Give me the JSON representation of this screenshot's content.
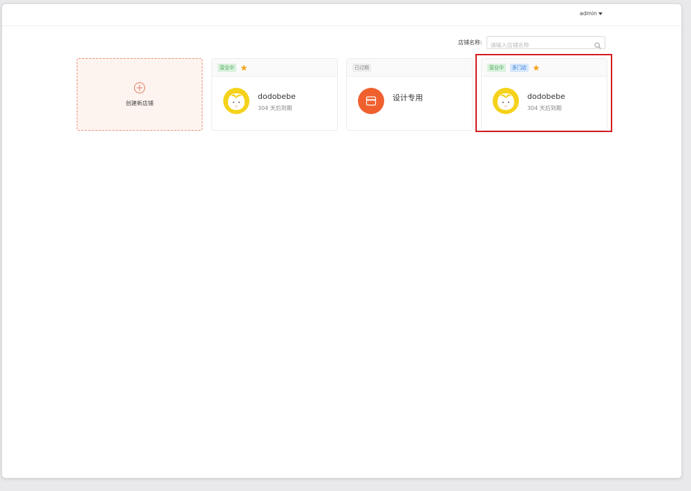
{
  "header": {
    "user": "admin"
  },
  "search": {
    "label": "店铺名称:",
    "placeholder": "请输入店铺名称"
  },
  "create_card": {
    "label": "创建新店铺"
  },
  "stores": [
    {
      "tags": [
        "营业中"
      ],
      "starred": true,
      "name": "dodobebe",
      "expire": "304 天后到期",
      "avatar": "baby-face-icon"
    },
    {
      "tags": [
        "已过期"
      ],
      "starred": false,
      "name": "设计专用",
      "expire": "",
      "avatar": "store-icon"
    },
    {
      "tags": [
        "营业中",
        "多门店"
      ],
      "starred": true,
      "name": "dodobebe",
      "expire": "304 天后到期",
      "avatar": "baby-face-icon"
    }
  ],
  "colors": {
    "accent_orange": "#f0602e",
    "avatar_yellow": "#f5d21b",
    "star": "#f5a623",
    "highlight": "#d1191b"
  }
}
